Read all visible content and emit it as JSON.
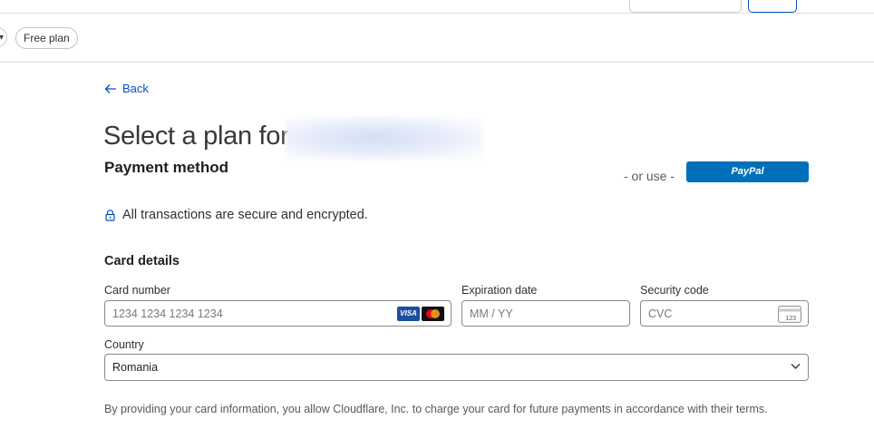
{
  "nav": {
    "filter_chip": "Free plan"
  },
  "back": {
    "label": "Back"
  },
  "header": {
    "title": "Select a plan for"
  },
  "payment": {
    "section_title": "Payment method",
    "or_use": "- or use -",
    "paypal_label": "PayPal",
    "secure_text": "All transactions are secure and encrypted."
  },
  "card": {
    "title": "Card details",
    "number_label": "Card number",
    "number_placeholder": "1234 1234 1234 1234",
    "visa_label": "VISA",
    "expiry_label": "Expiration date",
    "expiry_placeholder": "MM / YY",
    "cvc_label": "Security code",
    "cvc_placeholder": "CVC",
    "cvc_icon_text": "123",
    "country_label": "Country",
    "country_value": "Romania"
  },
  "notice": {
    "text": "By providing your card information, you allow Cloudflare, Inc. to charge your card for future payments in accordance with their terms."
  },
  "colors": {
    "accent": "#0051c3",
    "paypal": "#0070ba"
  }
}
